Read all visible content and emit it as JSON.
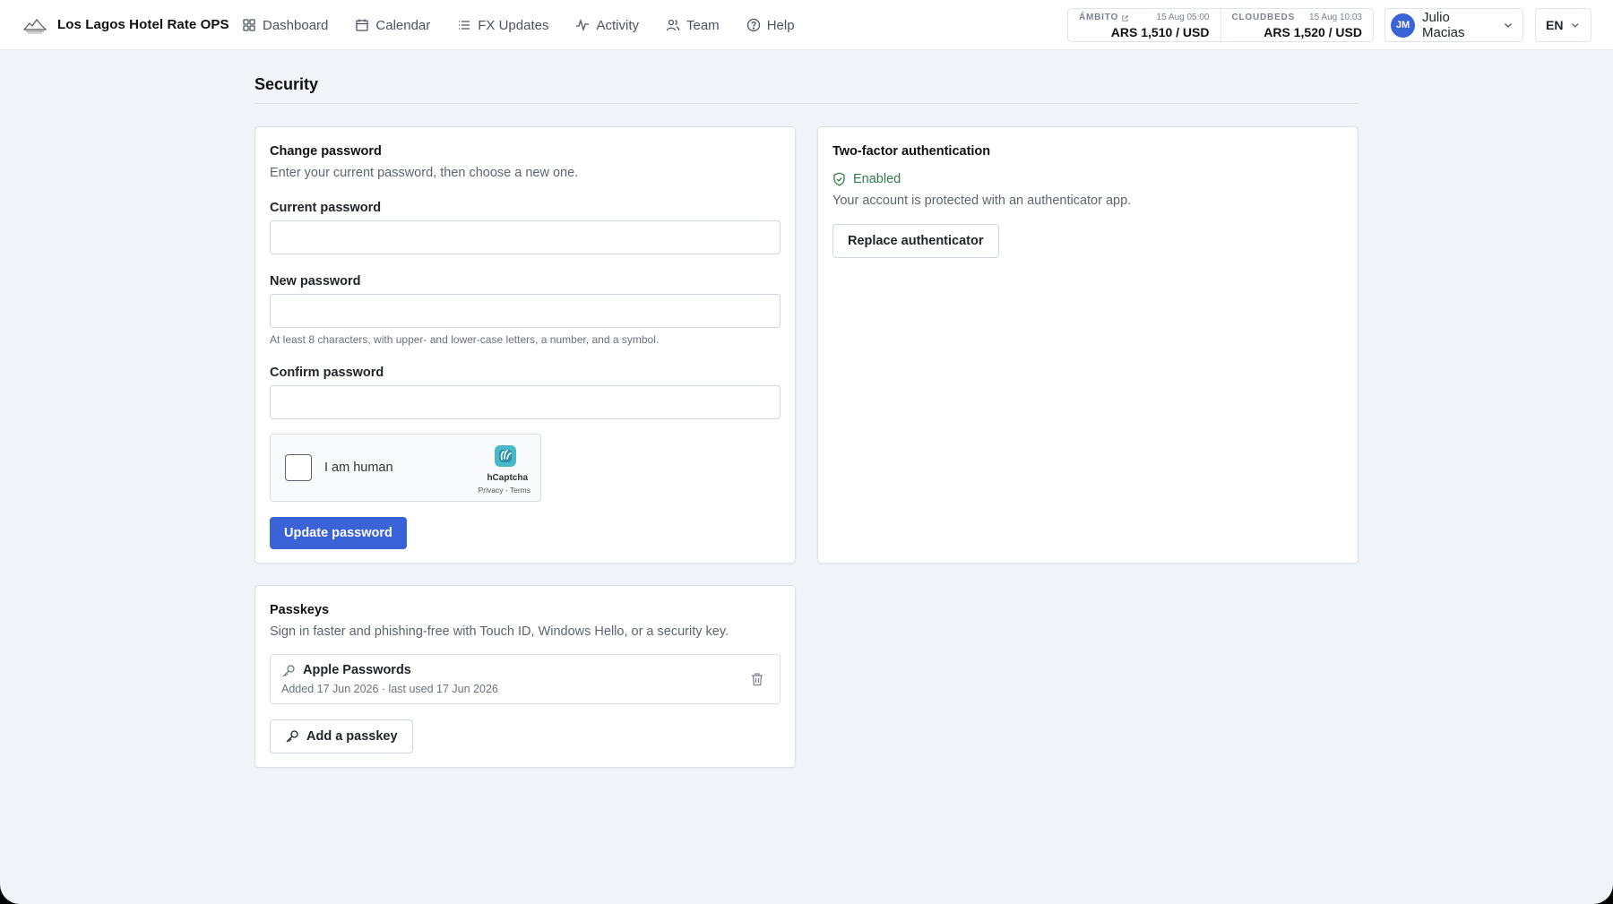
{
  "app": {
    "name": "Los Lagos Hotel Rate OPS"
  },
  "nav": [
    {
      "label": "Dashboard",
      "icon": "dashboard-icon"
    },
    {
      "label": "Calendar",
      "icon": "calendar-icon"
    },
    {
      "label": "FX Updates",
      "icon": "list-icon"
    },
    {
      "label": "Activity",
      "icon": "activity-icon"
    },
    {
      "label": "Team",
      "icon": "team-icon"
    },
    {
      "label": "Help",
      "icon": "help-icon"
    }
  ],
  "fx": [
    {
      "source": "ÁMBITO",
      "time": "15 Aug 05:00",
      "rate": "ARS 1,510 / USD"
    },
    {
      "source": "CLOUDBEDS",
      "time": "15 Aug 10:03",
      "rate": "ARS 1,520 / USD"
    }
  ],
  "user": {
    "initials": "JM",
    "name": "Julio Macias"
  },
  "language": "EN",
  "page": {
    "title": "Security"
  },
  "change_password": {
    "title": "Change password",
    "subtitle": "Enter your current password, then choose a new one.",
    "current_label": "Current password",
    "new_label": "New password",
    "new_hint": "At least 8 characters, with upper- and lower-case letters, a number, and a symbol.",
    "confirm_label": "Confirm password",
    "captcha": {
      "label": "I am human",
      "brand": "hCaptcha",
      "links": "Privacy - Terms"
    },
    "submit_label": "Update password"
  },
  "two_factor": {
    "title": "Two-factor authentication",
    "status": "Enabled",
    "description": "Your account is protected with an authenticator app.",
    "replace_label": "Replace authenticator"
  },
  "passkeys": {
    "title": "Passkeys",
    "subtitle": "Sign in faster and phishing-free with Touch ID, Windows Hello, or a security key.",
    "items": [
      {
        "name": "Apple Passwords",
        "meta": "Added 17 Jun 2026 · last used 17 Jun 2026"
      }
    ],
    "add_label": "Add a passkey"
  },
  "colors": {
    "accent": "#3a63d8",
    "success": "#2e7a4f",
    "background": "#f1f4f9"
  }
}
